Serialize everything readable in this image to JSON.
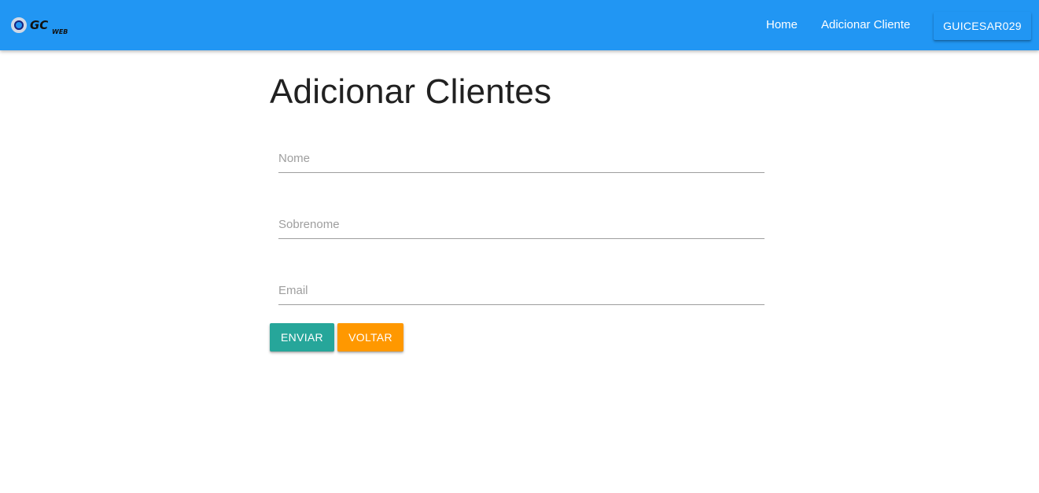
{
  "navbar": {
    "logo": {
      "text": "GC",
      "subtext": "WEB"
    },
    "links": [
      {
        "label": "Home"
      },
      {
        "label": "Adicionar Cliente"
      }
    ],
    "user_button": "GUICESAR029"
  },
  "page": {
    "title": "Adicionar Clientes"
  },
  "form": {
    "nome": {
      "value": "",
      "placeholder": "Nome"
    },
    "sobrenome": {
      "value": "",
      "placeholder": "Sobrenome"
    },
    "email": {
      "value": "",
      "placeholder": "Email"
    }
  },
  "buttons": {
    "enviar": "ENVIAR",
    "voltar": "VOLTAR"
  },
  "colors": {
    "navbar": "#2196f3",
    "enviar": "#26a69a",
    "voltar": "#ff9800"
  }
}
